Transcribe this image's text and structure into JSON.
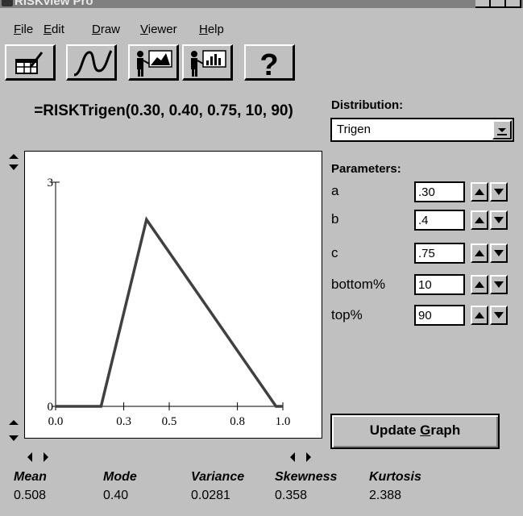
{
  "window": {
    "title": "RISKview Pro"
  },
  "menu": {
    "file": "File",
    "edit": "Edit",
    "draw": "Draw",
    "viewer": "Viewer",
    "help": "Help"
  },
  "toolbar": {
    "help_glyph": "?"
  },
  "formula": "=RISKTrigen(0.30, 0.40, 0.75, 10, 90)",
  "distribution": {
    "label": "Distribution:",
    "selected": "Trigen"
  },
  "parameters": {
    "label": "Parameters:",
    "items": [
      {
        "name": "a",
        "value": ".30"
      },
      {
        "name": "b",
        "value": ".4"
      },
      {
        "name": "c",
        "value": ".75"
      },
      {
        "name": "bottom%",
        "value": "10"
      },
      {
        "name": "top%",
        "value": "90"
      }
    ]
  },
  "update_button": {
    "label_pre": "Update ",
    "label_key": "G",
    "label_post": "raph"
  },
  "stats": {
    "headers": [
      "Mean",
      "Mode",
      "Variance",
      "Skewness",
      "Kurtosis"
    ],
    "values": [
      "0.508",
      "0.40",
      "0.0281",
      "0.358",
      "2.388"
    ]
  },
  "chart_data": {
    "type": "line",
    "x_ticks": [
      "0.0",
      "0.3",
      "0.5",
      "0.8",
      "1.0"
    ],
    "y_ticks": [
      "0",
      "3"
    ],
    "xlim": [
      0,
      1.0
    ],
    "ylim": [
      0,
      3
    ],
    "x": [
      0.0,
      0.2,
      0.4,
      0.97,
      1.0
    ],
    "y": [
      0,
      0,
      2.5,
      0,
      0
    ],
    "line_color": "#404040"
  }
}
